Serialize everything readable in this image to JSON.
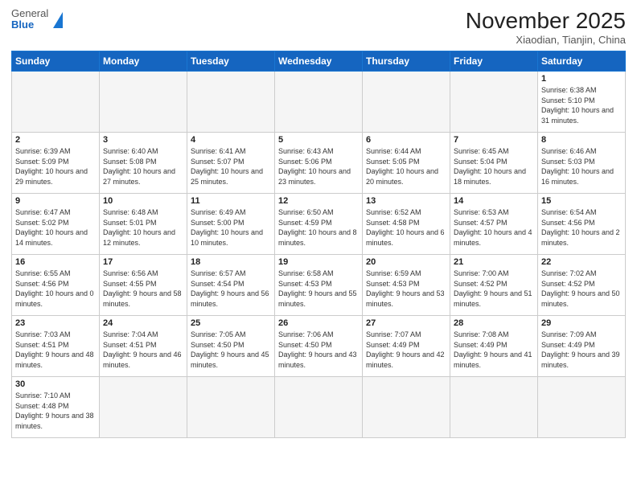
{
  "header": {
    "logo_general": "General",
    "logo_blue": "Blue",
    "title": "November 2025",
    "subtitle": "Xiaodian, Tianjin, China"
  },
  "days_of_week": [
    "Sunday",
    "Monday",
    "Tuesday",
    "Wednesday",
    "Thursday",
    "Friday",
    "Saturday"
  ],
  "weeks": [
    [
      {
        "day": "",
        "info": "",
        "empty": true
      },
      {
        "day": "",
        "info": "",
        "empty": true
      },
      {
        "day": "",
        "info": "",
        "empty": true
      },
      {
        "day": "",
        "info": "",
        "empty": true
      },
      {
        "day": "",
        "info": "",
        "empty": true
      },
      {
        "day": "",
        "info": "",
        "empty": true
      },
      {
        "day": "1",
        "info": "Sunrise: 6:38 AM\nSunset: 5:10 PM\nDaylight: 10 hours and 31 minutes."
      }
    ],
    [
      {
        "day": "2",
        "info": "Sunrise: 6:39 AM\nSunset: 5:09 PM\nDaylight: 10 hours and 29 minutes."
      },
      {
        "day": "3",
        "info": "Sunrise: 6:40 AM\nSunset: 5:08 PM\nDaylight: 10 hours and 27 minutes."
      },
      {
        "day": "4",
        "info": "Sunrise: 6:41 AM\nSunset: 5:07 PM\nDaylight: 10 hours and 25 minutes."
      },
      {
        "day": "5",
        "info": "Sunrise: 6:43 AM\nSunset: 5:06 PM\nDaylight: 10 hours and 23 minutes."
      },
      {
        "day": "6",
        "info": "Sunrise: 6:44 AM\nSunset: 5:05 PM\nDaylight: 10 hours and 20 minutes."
      },
      {
        "day": "7",
        "info": "Sunrise: 6:45 AM\nSunset: 5:04 PM\nDaylight: 10 hours and 18 minutes."
      },
      {
        "day": "8",
        "info": "Sunrise: 6:46 AM\nSunset: 5:03 PM\nDaylight: 10 hours and 16 minutes."
      }
    ],
    [
      {
        "day": "9",
        "info": "Sunrise: 6:47 AM\nSunset: 5:02 PM\nDaylight: 10 hours and 14 minutes."
      },
      {
        "day": "10",
        "info": "Sunrise: 6:48 AM\nSunset: 5:01 PM\nDaylight: 10 hours and 12 minutes."
      },
      {
        "day": "11",
        "info": "Sunrise: 6:49 AM\nSunset: 5:00 PM\nDaylight: 10 hours and 10 minutes."
      },
      {
        "day": "12",
        "info": "Sunrise: 6:50 AM\nSunset: 4:59 PM\nDaylight: 10 hours and 8 minutes."
      },
      {
        "day": "13",
        "info": "Sunrise: 6:52 AM\nSunset: 4:58 PM\nDaylight: 10 hours and 6 minutes."
      },
      {
        "day": "14",
        "info": "Sunrise: 6:53 AM\nSunset: 4:57 PM\nDaylight: 10 hours and 4 minutes."
      },
      {
        "day": "15",
        "info": "Sunrise: 6:54 AM\nSunset: 4:56 PM\nDaylight: 10 hours and 2 minutes."
      }
    ],
    [
      {
        "day": "16",
        "info": "Sunrise: 6:55 AM\nSunset: 4:56 PM\nDaylight: 10 hours and 0 minutes."
      },
      {
        "day": "17",
        "info": "Sunrise: 6:56 AM\nSunset: 4:55 PM\nDaylight: 9 hours and 58 minutes."
      },
      {
        "day": "18",
        "info": "Sunrise: 6:57 AM\nSunset: 4:54 PM\nDaylight: 9 hours and 56 minutes."
      },
      {
        "day": "19",
        "info": "Sunrise: 6:58 AM\nSunset: 4:53 PM\nDaylight: 9 hours and 55 minutes."
      },
      {
        "day": "20",
        "info": "Sunrise: 6:59 AM\nSunset: 4:53 PM\nDaylight: 9 hours and 53 minutes."
      },
      {
        "day": "21",
        "info": "Sunrise: 7:00 AM\nSunset: 4:52 PM\nDaylight: 9 hours and 51 minutes."
      },
      {
        "day": "22",
        "info": "Sunrise: 7:02 AM\nSunset: 4:52 PM\nDaylight: 9 hours and 50 minutes."
      }
    ],
    [
      {
        "day": "23",
        "info": "Sunrise: 7:03 AM\nSunset: 4:51 PM\nDaylight: 9 hours and 48 minutes."
      },
      {
        "day": "24",
        "info": "Sunrise: 7:04 AM\nSunset: 4:51 PM\nDaylight: 9 hours and 46 minutes."
      },
      {
        "day": "25",
        "info": "Sunrise: 7:05 AM\nSunset: 4:50 PM\nDaylight: 9 hours and 45 minutes."
      },
      {
        "day": "26",
        "info": "Sunrise: 7:06 AM\nSunset: 4:50 PM\nDaylight: 9 hours and 43 minutes."
      },
      {
        "day": "27",
        "info": "Sunrise: 7:07 AM\nSunset: 4:49 PM\nDaylight: 9 hours and 42 minutes."
      },
      {
        "day": "28",
        "info": "Sunrise: 7:08 AM\nSunset: 4:49 PM\nDaylight: 9 hours and 41 minutes."
      },
      {
        "day": "29",
        "info": "Sunrise: 7:09 AM\nSunset: 4:49 PM\nDaylight: 9 hours and 39 minutes."
      }
    ],
    [
      {
        "day": "30",
        "info": "Sunrise: 7:10 AM\nSunset: 4:48 PM\nDaylight: 9 hours and 38 minutes."
      },
      {
        "day": "",
        "info": "",
        "empty": true
      },
      {
        "day": "",
        "info": "",
        "empty": true
      },
      {
        "day": "",
        "info": "",
        "empty": true
      },
      {
        "day": "",
        "info": "",
        "empty": true
      },
      {
        "day": "",
        "info": "",
        "empty": true
      },
      {
        "day": "",
        "info": "",
        "empty": true
      }
    ]
  ]
}
